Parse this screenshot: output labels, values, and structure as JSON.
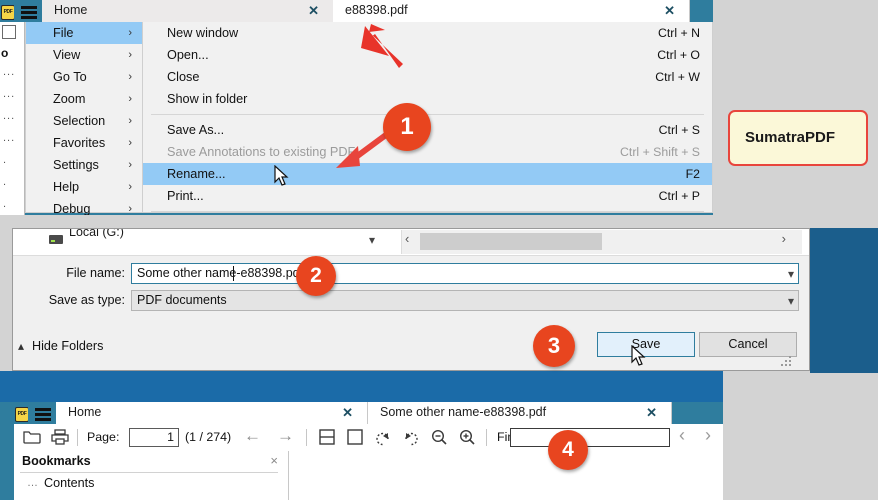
{
  "top_window": {
    "logo_text": "PDF",
    "menu_icon": "hamburger-icon",
    "tabs": [
      {
        "label": "Home",
        "close": "✕",
        "active": false
      },
      {
        "label": "e88398.pdf",
        "close": "✕",
        "active": true
      }
    ],
    "menu_column_1": [
      {
        "label": "File",
        "arrow": "›",
        "selected": true
      },
      {
        "label": "View",
        "arrow": "›",
        "selected": false
      },
      {
        "label": "Go To",
        "arrow": "›",
        "selected": false
      },
      {
        "label": "Zoom",
        "arrow": "›",
        "selected": false
      },
      {
        "label": "Selection",
        "arrow": "›",
        "selected": false
      },
      {
        "label": "Favorites",
        "arrow": "›",
        "selected": false
      },
      {
        "label": "Settings",
        "arrow": "›",
        "selected": false
      },
      {
        "label": "Help",
        "arrow": "›",
        "selected": false
      },
      {
        "label": "Debug",
        "arrow": "›",
        "selected": false
      }
    ],
    "menu_column_2": [
      {
        "label": "New window",
        "accel": "Ctrl + N",
        "selected": false,
        "disabled": false
      },
      {
        "label": "Open...",
        "accel": "Ctrl + O",
        "selected": false,
        "disabled": false
      },
      {
        "label": "Close",
        "accel": "Ctrl + W",
        "selected": false,
        "disabled": false
      },
      {
        "label": "Show in folder",
        "accel": "",
        "selected": false,
        "disabled": false
      },
      {
        "label": "Save As...",
        "accel": "Ctrl + S",
        "selected": false,
        "disabled": false
      },
      {
        "label": "Save Annotations to existing PDF",
        "accel": "Ctrl + Shift + S",
        "selected": false,
        "disabled": true
      },
      {
        "label": "Rename...",
        "accel": "F2",
        "selected": true,
        "disabled": false
      },
      {
        "label": "Print...",
        "accel": "Ctrl + P",
        "selected": false,
        "disabled": false
      }
    ]
  },
  "save_dialog": {
    "drive_label": "Local (G:)",
    "file_name_label": "File name:",
    "file_name_value": "Some other name-e88398.pdf",
    "save_as_type_label": "Save as type:",
    "save_as_type_value": "PDF documents",
    "hide_folders_label": "Hide Folders",
    "save_button": "Save",
    "cancel_button": "Cancel"
  },
  "bottom_window": {
    "logo_text": "PDF",
    "tabs": [
      {
        "label": "Home",
        "close": "✕",
        "active": true
      },
      {
        "label": "Some other name-e88398.pdf",
        "close": "✕",
        "active": true
      }
    ],
    "toolbar": {
      "open_icon": "folder-open-icon",
      "print_icon": "printer-icon",
      "page_label": "Page:",
      "page_value": "1",
      "page_total": "(1 / 274)",
      "prev_arrow": "←",
      "next_arrow": "→",
      "layout_icon": "facing-pages-icon",
      "single_page_icon": "single-page-icon",
      "rotate_left_icon": "rotate-left-icon",
      "rotate_right_icon": "rotate-right-icon",
      "zoom_out_icon": "zoom-out-icon",
      "zoom_in_icon": "zoom-in-icon",
      "find_label": "Find:",
      "find_value": "",
      "find_prev": "‹",
      "find_next": "›"
    },
    "bookmarks": {
      "title": "Bookmarks",
      "close": "×",
      "items": [
        {
          "label": "Contents"
        }
      ]
    }
  },
  "callout": {
    "app_name": "SumatraPDF"
  },
  "annotations": {
    "step_1": "1",
    "step_2": "2",
    "step_3": "3",
    "step_4": "4"
  },
  "colors": {
    "accent_teal": "#2f7d9e",
    "selection_blue": "#93caf5",
    "badge_orange": "#e8451f",
    "callout_border": "#e8453c",
    "callout_fill": "#fbf8d8",
    "desktop_blue": "#1b5e8c"
  }
}
